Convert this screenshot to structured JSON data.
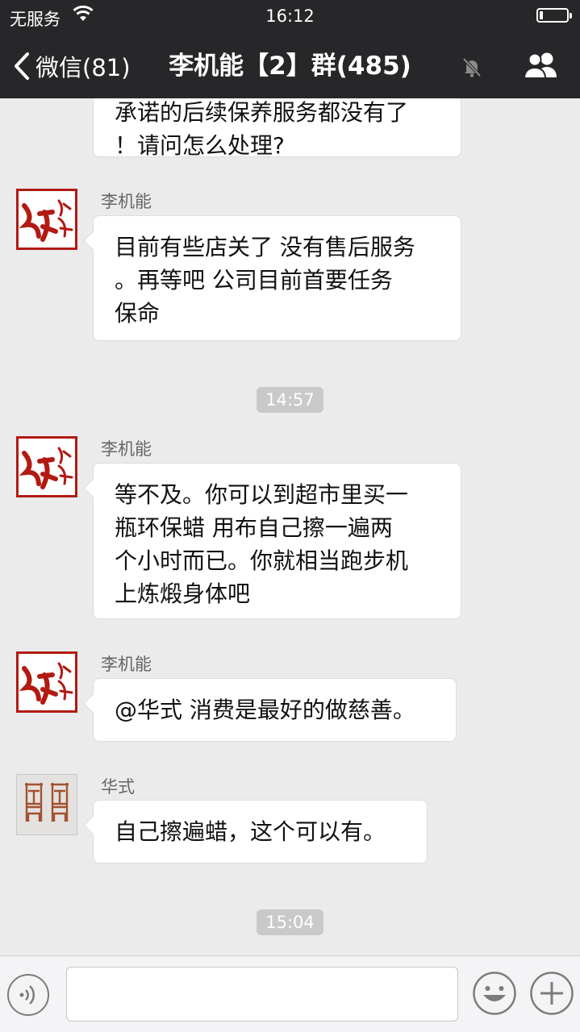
{
  "status_bar": {
    "carrier": "无服务",
    "time": "16:12"
  },
  "nav": {
    "back_label": "微信(81)",
    "title": "李机能【2】群(485)"
  },
  "messages": [
    {
      "type": "text",
      "continuation": true,
      "lines": [
        "承诺的后续保养服务都没有了",
        "！请问怎么处理?"
      ]
    },
    {
      "type": "text",
      "sender": "李机能",
      "avatar": "hong-seal",
      "lines": [
        "目前有些店关了 没有售后服务",
        "。再等吧  公司目前首要任务",
        "保命"
      ]
    },
    {
      "type": "timestamp",
      "text": "14:57"
    },
    {
      "type": "text",
      "sender": "李机能",
      "avatar": "hong-seal",
      "lines": [
        "等不及。你可以到超市里买一",
        "瓶环保蜡  用布自己擦一遍两",
        "个小时而已。你就相当跑步机",
        "上炼煅身体吧"
      ]
    },
    {
      "type": "text",
      "sender": "李机能",
      "avatar": "hong-seal",
      "lines": [
        "@华式 消费是最好的做慈善。"
      ]
    },
    {
      "type": "text",
      "sender": "华式",
      "avatar": "chairs",
      "lines": [
        "自己擦遍蜡，这个可以有。"
      ]
    },
    {
      "type": "timestamp",
      "text": "15:04"
    }
  ],
  "input_bar": {
    "text_value": ""
  },
  "icons": [
    "wifi-icon",
    "battery-icon",
    "back-chevron-icon",
    "mute-bell-icon",
    "group-members-icon",
    "voice-icon",
    "emoji-icon",
    "plus-icon"
  ]
}
